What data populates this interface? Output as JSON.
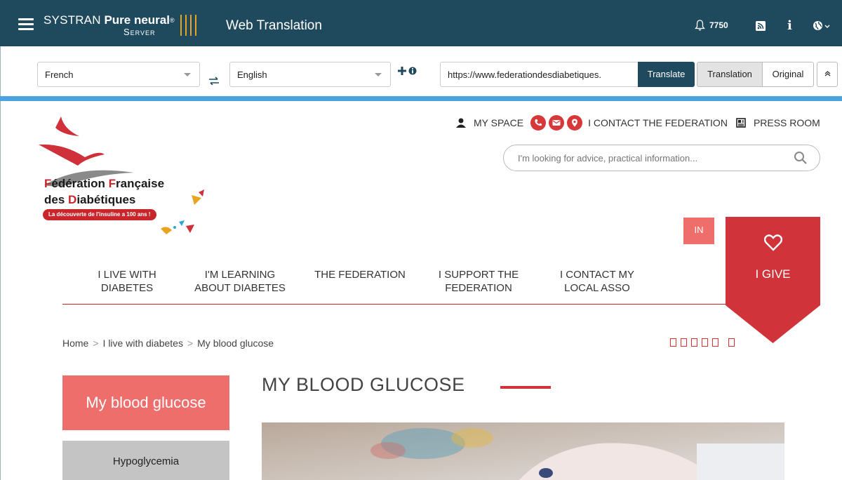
{
  "app": {
    "brand_line1": "SYSTRAN",
    "brand_line1_bold": "Pure neural",
    "brand_reg": "®",
    "brand_server": "Server",
    "title": "Web Translation",
    "notification_count": "7750"
  },
  "toolbar": {
    "source_lang": "French",
    "target_lang": "English",
    "url_value": "https://www.federationdesdiabetiques.",
    "translate_label": "Translate",
    "translation_label": "Translation",
    "original_label": "Original"
  },
  "site": {
    "logo": {
      "line1_a": "F",
      "line1_b": "édération ",
      "line1_c": "F",
      "line1_d": "rançaise",
      "line2_a": "des ",
      "line2_b": "D",
      "line2_c": "iabétiques",
      "banner": "La découverte de l'insuline a 100 ans !"
    },
    "utility_nav": {
      "my_space": "MY SPACE",
      "contact_federation": "I CONTACT THE FEDERATION",
      "press_room": "PRESS ROOM"
    },
    "search_placeholder": "I'm looking for advice, practical information...",
    "lang_button": "IN",
    "give_label": "I GIVE",
    "main_nav": [
      {
        "line1": "I LIVE WITH",
        "line2": "DIABETES"
      },
      {
        "line1": "I'M LEARNING",
        "line2": "ABOUT DIABETES"
      },
      {
        "line1": "THE FEDERATION",
        "line2": ""
      },
      {
        "line1": "I SUPPORT THE",
        "line2": "FEDERATION"
      },
      {
        "line1": "I CONTACT MY",
        "line2": "LOCAL ASSO"
      }
    ],
    "breadcrumb": {
      "home": "Home",
      "sep": ">",
      "level1": "I live with diabetes",
      "level2": "My blood glucose"
    },
    "sidebar": {
      "title": "My blood glucose",
      "items": [
        "Hypoglycemia"
      ]
    },
    "page_title": "MY BLOOD GLUCOSE"
  },
  "colors": {
    "app_bar": "#1f4a5e",
    "accent_blue": "#4aa3df",
    "brand_red": "#c9262c",
    "salmon": "#ee6e6c"
  }
}
